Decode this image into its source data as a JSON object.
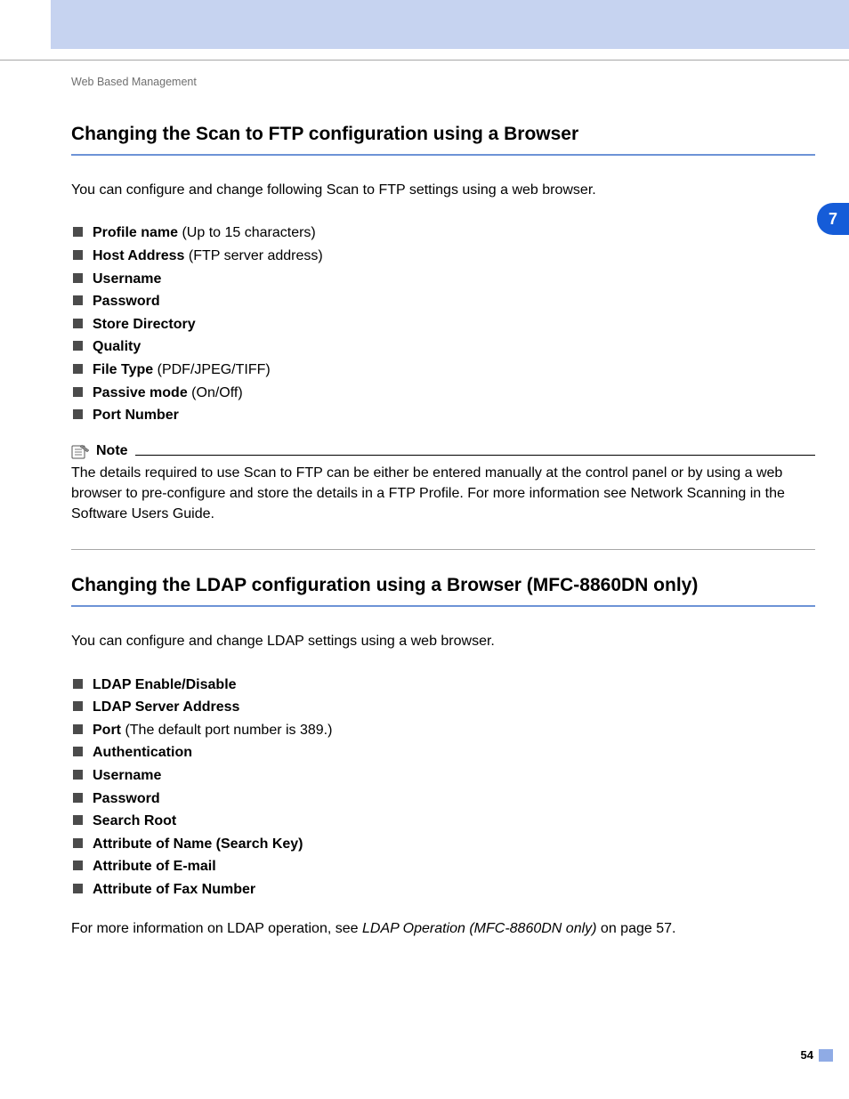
{
  "breadcrumb": "Web Based Management",
  "sideTab": "7",
  "pageNumber": "54",
  "section1": {
    "heading": "Changing the Scan to FTP configuration using a Browser",
    "intro": "You can configure and change following Scan to FTP settings using a web browser.",
    "items": [
      {
        "bold": "Profile name",
        "rest": " (Up to 15 characters)"
      },
      {
        "bold": "Host Address",
        "rest": " (FTP server address)"
      },
      {
        "bold": "Username",
        "rest": ""
      },
      {
        "bold": "Password",
        "rest": ""
      },
      {
        "bold": "Store Directory",
        "rest": ""
      },
      {
        "bold": "Quality",
        "rest": ""
      },
      {
        "bold": "File Type",
        "rest": " (PDF/JPEG/TIFF)"
      },
      {
        "bold": "Passive mode",
        "rest": " (On/Off)"
      },
      {
        "bold": "Port Number",
        "rest": ""
      }
    ],
    "note": {
      "label": "Note",
      "body": "The details required to use Scan to FTP can be either be entered manually at the control panel or by using a web browser to pre-configure and store the details in a FTP Profile. For more information see Network Scanning in the Software Users Guide."
    }
  },
  "section2": {
    "heading": "Changing the LDAP configuration using a Browser (MFC-8860DN only)",
    "intro": "You can configure and change LDAP settings using a web browser.",
    "items": [
      {
        "bold": "LDAP Enable/Disable",
        "rest": ""
      },
      {
        "bold": "LDAP Server Address",
        "rest": ""
      },
      {
        "bold": "Port",
        "rest": " (The default port number is 389.)"
      },
      {
        "bold": "Authentication",
        "rest": ""
      },
      {
        "bold": "Username",
        "rest": ""
      },
      {
        "bold": "Password",
        "rest": ""
      },
      {
        "bold": "Search Root",
        "rest": ""
      },
      {
        "bold": "Attribute of Name (Search Key)",
        "rest": ""
      },
      {
        "bold": "Attribute of E-mail",
        "rest": ""
      },
      {
        "bold": "Attribute of Fax Number",
        "rest": ""
      }
    ],
    "closing": {
      "prefix": "For more information on LDAP operation, see ",
      "italic": "LDAP Operation (MFC-8860DN only)",
      "suffix": " on page 57."
    }
  }
}
